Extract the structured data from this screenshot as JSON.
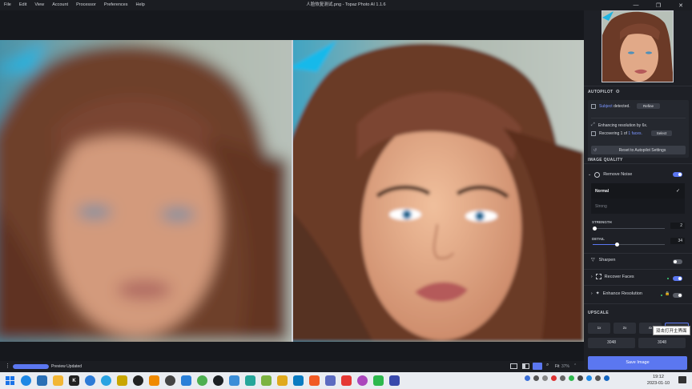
{
  "titlebar": {
    "menu": [
      "File",
      "Edit",
      "View",
      "Account",
      "Processor",
      "Preferences",
      "Help"
    ],
    "title": "人脸恢复测试.png - Topaz Photo AI 1.1.6",
    "controls": {
      "minimize": "—",
      "maximize": "❐",
      "close": "✕"
    }
  },
  "autopilot": {
    "heading": "AUTOPILOT",
    "subject_word": "Subject",
    "subject_rest": " detected.",
    "refine": "Refine",
    "enhancing": "Enhancing resolution by 6x.",
    "recover_prefix": "Recovering 1 of ",
    "recover_link": "1 faces.",
    "select": "Select",
    "reset": "Reset to Autopilot Settings"
  },
  "quality": {
    "heading": "IMAGE QUALITY",
    "remove_noise": "Remove Noise",
    "mode_normal": "Normal",
    "mode_strong": "Strong",
    "strength_label": "STRENGTH",
    "strength_value": "2",
    "strength_fraction": 0.03,
    "detail_label": "DETAIL",
    "detail_value": "34",
    "detail_fraction": 0.34,
    "sharpen": "Sharpen",
    "recover_faces": "Recover Faces",
    "enhance_resolution": "Enhance Resolution"
  },
  "upscale": {
    "heading": "UPSCALE",
    "options": [
      "1x",
      "2x",
      "4x"
    ],
    "tooltip": "双击打开主界面",
    "width": "3048",
    "height": "3048"
  },
  "save_label": "Save Image",
  "status": {
    "label": "Preview Updated",
    "progress": 1.0,
    "zoom_label": "Fit",
    "zoom_value": "37%"
  },
  "clock": {
    "time": "19:12",
    "date": "2023-01-10"
  },
  "colors": {
    "accent": "#5b77f0",
    "toggle_on": "#5b77f0",
    "status_dot": "#3fd27a"
  }
}
